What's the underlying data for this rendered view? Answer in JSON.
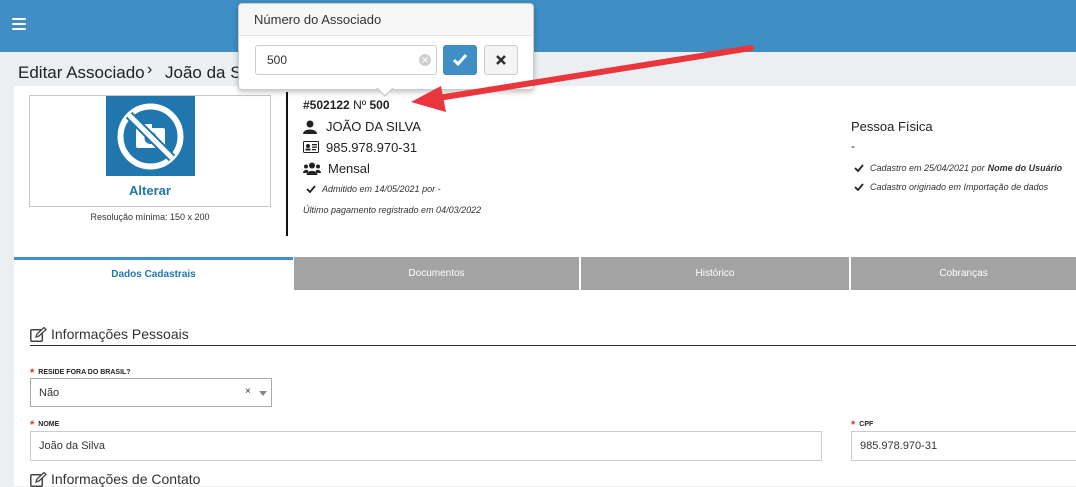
{
  "breadcrumb": {
    "title": "Editar Associado",
    "separator": "›",
    "current": "João da Silva"
  },
  "photo": {
    "action_label": "Alterar",
    "resolution_note": "Resolução mínima: 150 x 200"
  },
  "associate": {
    "id_label": "#502122",
    "number_prefix": "Nº",
    "number": "500",
    "name": "JOÃO DA SILVA",
    "document": "985.978.970-31",
    "plan": "Mensal",
    "admitted": "Admitido em 14/05/2021 por -",
    "last_payment": "Último pagamento registrado em 04/03/2022"
  },
  "person_type": {
    "label": "Pessoa Física",
    "dash": "-",
    "registered_prefix": "Cadastro em 25/04/2021 por ",
    "registered_user": "Nome do Usuário",
    "origin": "Cadastro originado em Importação de dados"
  },
  "tabs": [
    {
      "label": "Dados Cadastrais",
      "active": true
    },
    {
      "label": "Documentos",
      "active": false
    },
    {
      "label": "Histórico",
      "active": false
    },
    {
      "label": "Cobranças",
      "active": false
    }
  ],
  "sections": {
    "personal": "Informações Pessoais",
    "contact": "Informações de Contato"
  },
  "form": {
    "abroad_label": "RESIDE FORA DO BRASIL?",
    "abroad_value": "Não",
    "abroad_clear": "×",
    "name_label": "NOME",
    "name_value": "João da Silva",
    "cpf_label": "CPF",
    "cpf_value": "985.978.970-31",
    "required_mark": "*"
  },
  "popover": {
    "title": "Número do Associado",
    "input_value": "500",
    "clear_icon": "clear-circle-icon",
    "confirm_icon": "check-icon",
    "cancel_icon": "close-icon"
  },
  "colors": {
    "topbar": "#3f8fc4",
    "accent": "#1f77ad",
    "required": "#d9342b",
    "annotation_arrow": "#e8363c"
  }
}
